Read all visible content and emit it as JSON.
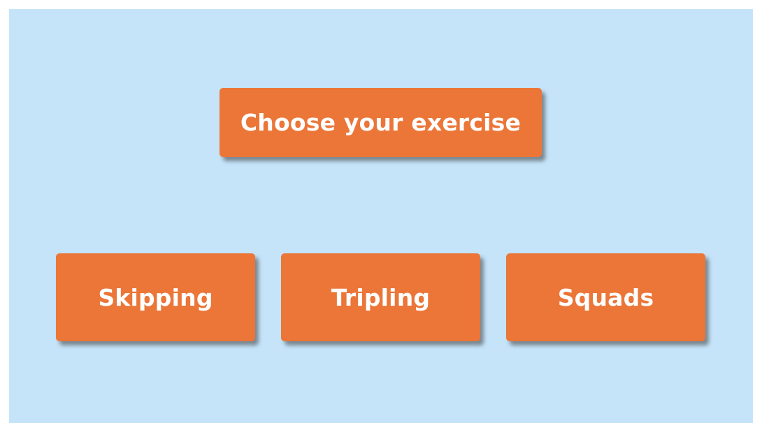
{
  "heading": {
    "label": "Choose your exercise"
  },
  "options": [
    {
      "label": "Skipping"
    },
    {
      "label": "Tripling"
    },
    {
      "label": "Squads"
    }
  ],
  "colors": {
    "background": "#c5e4fa",
    "tile": "#eb7638",
    "text": "#ffffff"
  }
}
